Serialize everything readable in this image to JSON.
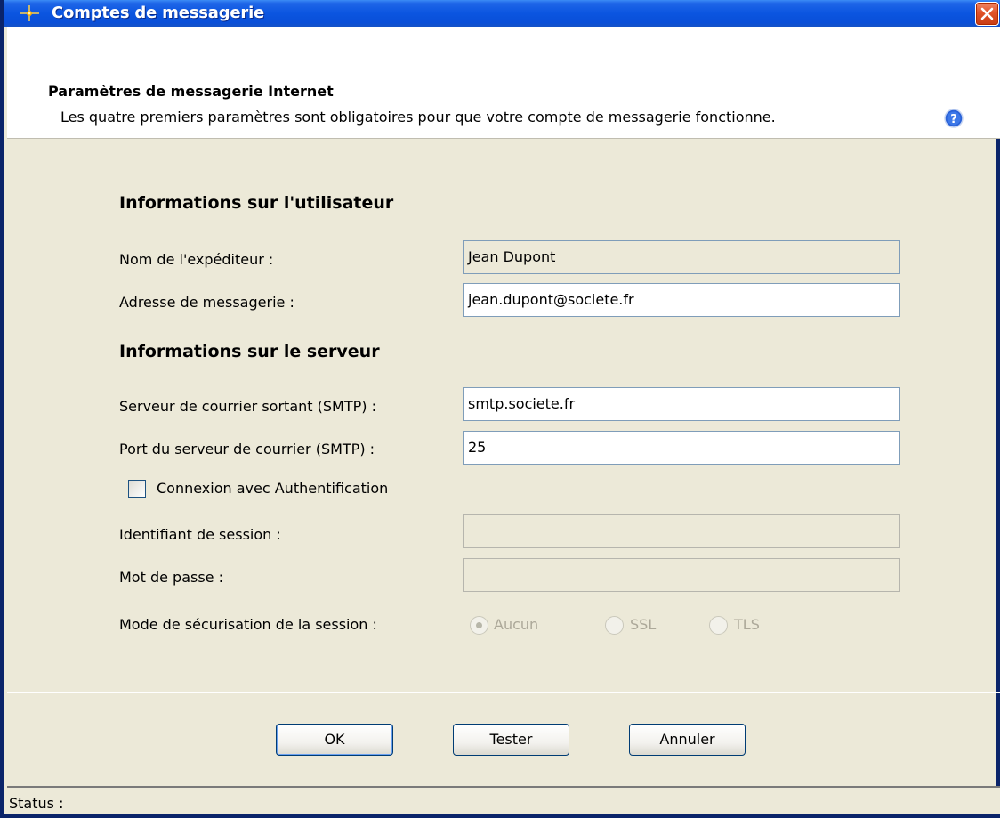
{
  "window": {
    "title": "Comptes de messagerie"
  },
  "header": {
    "title": "Paramètres de messagerie Internet",
    "subtitle": "Les quatre premiers paramètres sont obligatoires pour que votre compte de messagerie fonctionne."
  },
  "user_section": {
    "title": "Informations sur l'utilisateur",
    "sender_label": "Nom de l'expéditeur :",
    "sender_value": "Jean Dupont",
    "email_label": "Adresse de messagerie :",
    "email_value": "jean.dupont@societe.fr"
  },
  "server_section": {
    "title": "Informations sur le serveur",
    "smtp_label": "Serveur de courrier sortant (SMTP) :",
    "smtp_value": "smtp.societe.fr",
    "port_label": "Port du serveur de courrier (SMTP) :",
    "port_value": "25",
    "auth_label": "Connexion avec Authentification",
    "auth_checked": false,
    "login_label": "Identifiant de session :",
    "login_value": "",
    "password_label": "Mot de passe :",
    "password_value": "",
    "security_label": "Mode de sécurisation de la session :",
    "security_options": [
      "Aucun",
      "SSL",
      "TLS"
    ],
    "security_selected": "Aucun"
  },
  "buttons": {
    "ok": "OK",
    "test": "Tester",
    "cancel": "Annuler"
  },
  "status": {
    "label": "Status :"
  },
  "icons": {
    "title": "app-star-icon",
    "close": "close-icon",
    "help": "help-icon"
  },
  "colors": {
    "titlebar": "#0b55e0",
    "close": "#e0532a",
    "background": "#ece9d8"
  }
}
